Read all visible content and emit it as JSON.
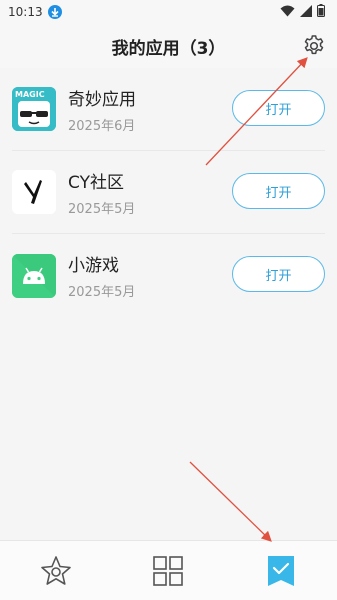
{
  "status_bar": {
    "time": "10:13"
  },
  "header": {
    "title": "我的应用（3）"
  },
  "apps": [
    {
      "name": "奇妙应用",
      "date": "2025年6月",
      "button": "打开",
      "icon": "magic-app-icon",
      "icon_text": "MAGIC"
    },
    {
      "name": "CY社区",
      "date": "2025年5月",
      "button": "打开",
      "icon": "cy-community-icon"
    },
    {
      "name": "小游戏",
      "date": "2025年5月",
      "button": "打开",
      "icon": "android-icon"
    }
  ],
  "bottom_nav": {
    "items": [
      {
        "icon": "star-icon",
        "active": false
      },
      {
        "icon": "grid-icon",
        "active": false
      },
      {
        "icon": "check-bookmark-icon",
        "active": true
      }
    ]
  },
  "colors": {
    "accent": "#2f9fd8",
    "button_border": "#5ab9e8",
    "annotation_arrow": "#e0513f",
    "active_tab": "#39b7e8"
  }
}
